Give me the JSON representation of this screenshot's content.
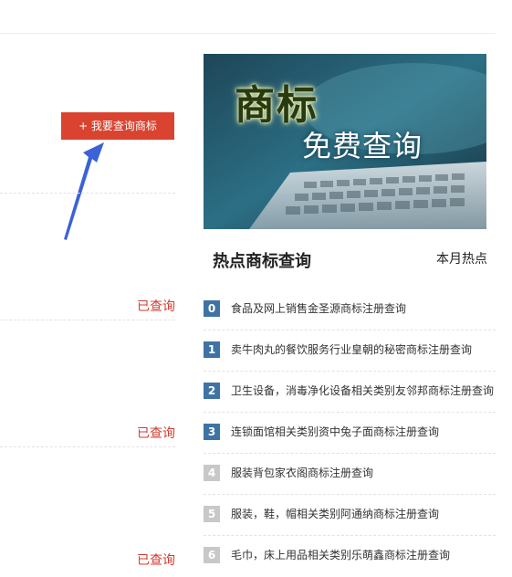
{
  "left": {
    "query_button_label": "+ 我要查询商标",
    "status_labels": [
      "已查询",
      "已查询",
      "已查询"
    ]
  },
  "banner": {
    "title": "商标",
    "subtitle": "免费查询"
  },
  "hot": {
    "title": "热点商标查询",
    "tab_label": "本月热点",
    "items": [
      {
        "rank": "0",
        "text": "食品及网上销售金圣源商标注册查询"
      },
      {
        "rank": "1",
        "text": "卖牛肉丸的餐饮服务行业皇朝的秘密商标注册查询"
      },
      {
        "rank": "2",
        "text": "卫生设备，消毒净化设备相关类别友邻邦商标注册查询"
      },
      {
        "rank": "3",
        "text": "连锁面馆相关类别资中兔子面商标注册查询"
      },
      {
        "rank": "4",
        "text": "服装背包家衣阁商标注册查询"
      },
      {
        "rank": "5",
        "text": "服装，鞋，帽相关类别阿通纳商标注册查询"
      },
      {
        "rank": "6",
        "text": "毛巾，床上用品相关类别乐萌鑫商标注册查询"
      }
    ]
  },
  "colors": {
    "accent_red": "#d9432f",
    "status_red": "#d43a2f",
    "rank_blue": "#3f73a5",
    "rank_gray": "#c8c8c8",
    "arrow_blue": "#3b62d6"
  }
}
